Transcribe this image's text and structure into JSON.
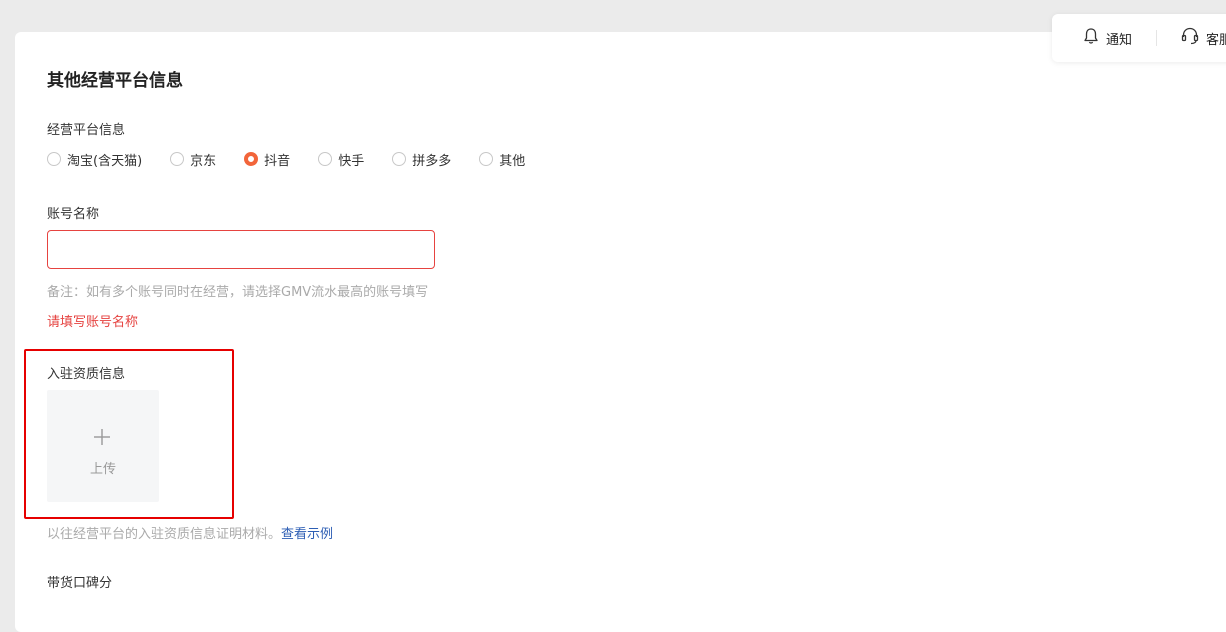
{
  "topbar": {
    "notify_label": "通知",
    "service_label": "客服"
  },
  "section": {
    "title": "其他经营平台信息"
  },
  "platform": {
    "label": "经营平台信息",
    "selected": "抖音",
    "options": [
      "淘宝(含天猫)",
      "京东",
      "抖音",
      "快手",
      "拼多多",
      "其他"
    ]
  },
  "account": {
    "label": "账号名称",
    "value": "",
    "hint": "备注：如有多个账号同时在经营，请选择GMV流水最高的账号填写",
    "error": "请填写账号名称"
  },
  "qualification": {
    "label": "入驻资质信息",
    "upload_label": "上传",
    "note": "以往经营平台的入驻资质信息证明材料。",
    "example_link": "查看示例"
  },
  "next_section": {
    "label": "带货口碑分"
  },
  "colors": {
    "accent": "#f2653a",
    "error": "#e64340",
    "link": "#2d5eb4",
    "highlight": "#e60000"
  }
}
